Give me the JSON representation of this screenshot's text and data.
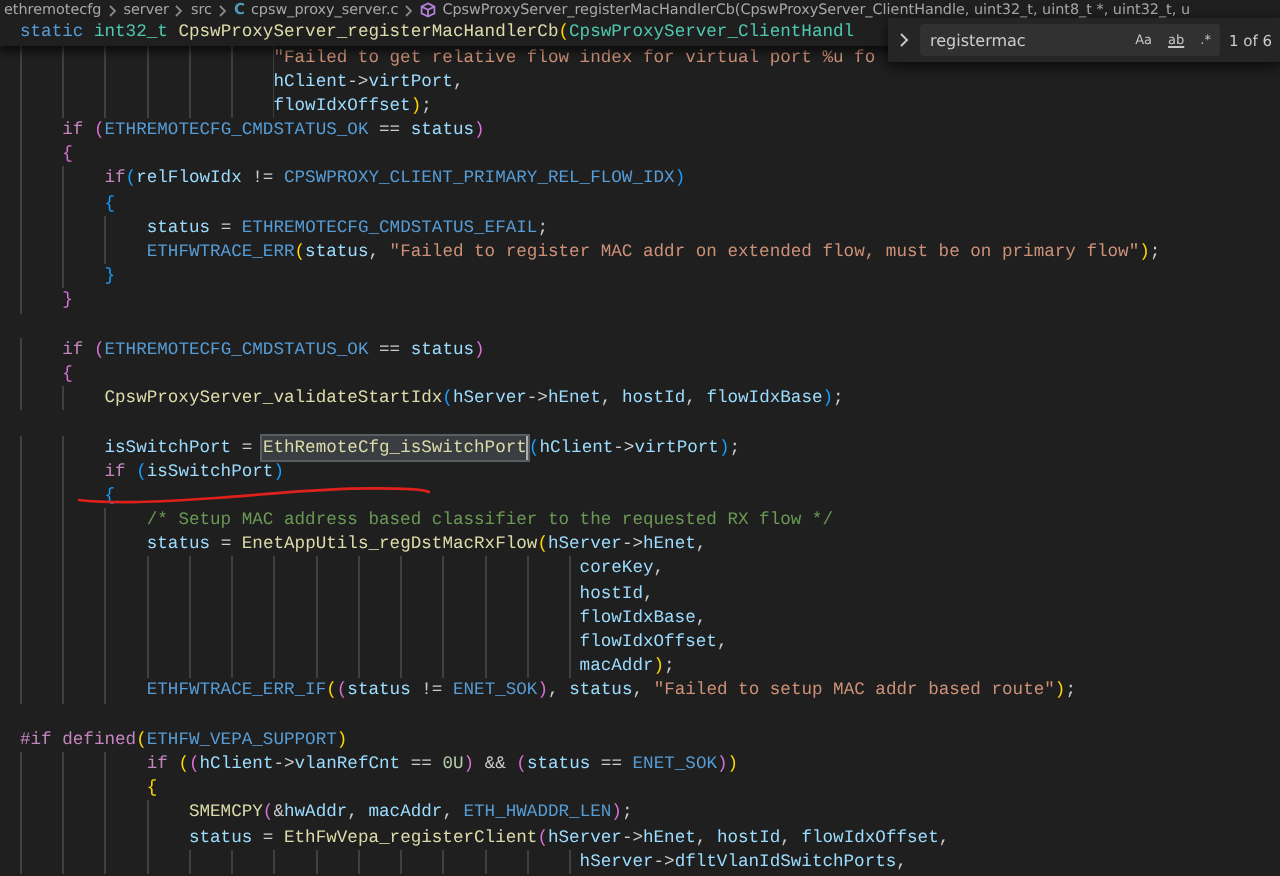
{
  "breadcrumb": {
    "items": [
      {
        "kind": "folder",
        "text": "ethremotecfg"
      },
      {
        "kind": "folder",
        "text": "server"
      },
      {
        "kind": "folder",
        "text": "src"
      },
      {
        "kind": "file",
        "glyph": "C",
        "text": "cpsw_proxy_server.c"
      },
      {
        "kind": "method",
        "text": "CpswProxyServer_registerMacHandlerCb(CpswProxyServer_ClientHandle, uint32_t, uint8_t *, uint32_t, u"
      }
    ]
  },
  "sticky_line": {
    "tokens": [
      {
        "kind": "st",
        "text": "static"
      },
      {
        "kind": "ty",
        "text": " int32_t"
      },
      {
        "kind": "fn",
        "text": " CpswProxyServer_registerMacHandlerCb"
      },
      {
        "kind": "b1",
        "text": "("
      },
      {
        "kind": "ty",
        "text": "CpswProxyServer_ClientHandl"
      }
    ]
  },
  "find_widget": {
    "query": "registermac",
    "options": [
      {
        "label": "Aa",
        "selected": false
      },
      {
        "label": "ab",
        "selected": false
      },
      {
        "label": ".*",
        "selected": false
      }
    ],
    "result": "1 of 6"
  },
  "lines": [
    {
      "kind": "code",
      "tokens": [
        {
          "kind": "str",
          "text": "                        \"Failed to get relative flow index for virtual port %u fo"
        }
      ]
    },
    {
      "kind": "code",
      "tokens": [
        {
          "kind": "var",
          "text": "                        hClient"
        },
        {
          "kind": "pl",
          "text": "->"
        },
        {
          "kind": "var",
          "text": "virtPort"
        },
        {
          "kind": "pl",
          "text": ","
        }
      ]
    },
    {
      "kind": "code",
      "tokens": [
        {
          "kind": "var",
          "text": "                        flowIdxOffset"
        },
        {
          "kind": "b1",
          "text": ")"
        },
        {
          "kind": "pl",
          "text": ";"
        }
      ]
    },
    {
      "kind": "code",
      "tokens": [
        {
          "kind": "kw",
          "text": "    if"
        },
        {
          "kind": "b2",
          "text": " ("
        },
        {
          "kind": "st",
          "text": "ETHREMOTECFG_CMDSTATUS_OK"
        },
        {
          "kind": "pl",
          "text": " == "
        },
        {
          "kind": "var",
          "text": "status"
        },
        {
          "kind": "b2",
          "text": ")"
        }
      ]
    },
    {
      "kind": "code",
      "tokens": [
        {
          "kind": "b2",
          "text": "    {"
        }
      ]
    },
    {
      "kind": "code",
      "tokens": [
        {
          "kind": "kw",
          "text": "        if"
        },
        {
          "kind": "b3",
          "text": "("
        },
        {
          "kind": "var",
          "text": "relFlowIdx"
        },
        {
          "kind": "pl",
          "text": " != "
        },
        {
          "kind": "st",
          "text": "CPSWPROXY_CLIENT_PRIMARY_REL_FLOW_IDX"
        },
        {
          "kind": "b3",
          "text": ")"
        }
      ]
    },
    {
      "kind": "code",
      "tokens": [
        {
          "kind": "b3",
          "text": "        {"
        }
      ]
    },
    {
      "kind": "code",
      "tokens": [
        {
          "kind": "var",
          "text": "            status"
        },
        {
          "kind": "pl",
          "text": " = "
        },
        {
          "kind": "st",
          "text": "ETHREMOTECFG_CMDSTATUS_EFAIL"
        },
        {
          "kind": "pl",
          "text": ";"
        }
      ]
    },
    {
      "kind": "code",
      "tokens": [
        {
          "kind": "st",
          "text": "            ETHFWTRACE_ERR"
        },
        {
          "kind": "b1",
          "text": "("
        },
        {
          "kind": "var",
          "text": "status"
        },
        {
          "kind": "pl",
          "text": ", "
        },
        {
          "kind": "str",
          "text": "\"Failed to register MAC addr on extended flow, must be on primary flow\""
        },
        {
          "kind": "b1",
          "text": ")"
        },
        {
          "kind": "pl",
          "text": ";"
        }
      ]
    },
    {
      "kind": "code",
      "tokens": [
        {
          "kind": "b3",
          "text": "        }"
        }
      ]
    },
    {
      "kind": "code",
      "tokens": [
        {
          "kind": "b2",
          "text": "    }"
        }
      ]
    },
    {
      "kind": "blank"
    },
    {
      "kind": "code",
      "tokens": [
        {
          "kind": "kw",
          "text": "    if"
        },
        {
          "kind": "b2",
          "text": " ("
        },
        {
          "kind": "st",
          "text": "ETHREMOTECFG_CMDSTATUS_OK"
        },
        {
          "kind": "pl",
          "text": " == "
        },
        {
          "kind": "var",
          "text": "status"
        },
        {
          "kind": "b2",
          "text": ")"
        }
      ]
    },
    {
      "kind": "code",
      "tokens": [
        {
          "kind": "b2",
          "text": "    {"
        }
      ]
    },
    {
      "kind": "code",
      "tokens": [
        {
          "kind": "fn",
          "text": "        CpswProxyServer_validateStartIdx"
        },
        {
          "kind": "b3",
          "text": "("
        },
        {
          "kind": "var",
          "text": "hServer"
        },
        {
          "kind": "pl",
          "text": "->"
        },
        {
          "kind": "var",
          "text": "hEnet"
        },
        {
          "kind": "pl",
          "text": ", "
        },
        {
          "kind": "var",
          "text": "hostId"
        },
        {
          "kind": "pl",
          "text": ", "
        },
        {
          "kind": "var",
          "text": "flowIdxBase"
        },
        {
          "kind": "b3",
          "text": ")"
        },
        {
          "kind": "pl",
          "text": ";"
        }
      ]
    },
    {
      "kind": "blank"
    },
    {
      "kind": "code",
      "tokens": [
        {
          "kind": "var",
          "text": "        isSwitchPort"
        },
        {
          "kind": "pl",
          "text": " = "
        },
        {
          "kind": "hl",
          "text": "EthRemoteCfg_isSwitchPort"
        },
        {
          "kind": "b3",
          "text": "("
        },
        {
          "kind": "var",
          "text": "hClient"
        },
        {
          "kind": "pl",
          "text": "->"
        },
        {
          "kind": "var",
          "text": "virtPort"
        },
        {
          "kind": "b3",
          "text": ")"
        },
        {
          "kind": "pl",
          "text": ";"
        }
      ]
    },
    {
      "kind": "code",
      "tokens": [
        {
          "kind": "kw",
          "text": "        if"
        },
        {
          "kind": "b3",
          "text": " ("
        },
        {
          "kind": "var",
          "text": "isSwitchPort"
        },
        {
          "kind": "b3",
          "text": ")"
        }
      ]
    },
    {
      "kind": "code",
      "tokens": [
        {
          "kind": "b3",
          "text": "        {"
        }
      ]
    },
    {
      "kind": "code",
      "tokens": [
        {
          "kind": "cmt",
          "text": "            /* Setup MAC address based classifier to the requested RX flow */"
        }
      ]
    },
    {
      "kind": "code",
      "tokens": [
        {
          "kind": "var",
          "text": "            status"
        },
        {
          "kind": "pl",
          "text": " = "
        },
        {
          "kind": "fn",
          "text": "EnetAppUtils_regDstMacRxFlow"
        },
        {
          "kind": "b1",
          "text": "("
        },
        {
          "kind": "var",
          "text": "hServer"
        },
        {
          "kind": "pl",
          "text": "->"
        },
        {
          "kind": "var",
          "text": "hEnet"
        },
        {
          "kind": "pl",
          "text": ","
        }
      ]
    },
    {
      "kind": "code",
      "tokens": [
        {
          "kind": "var",
          "text": "                                                     coreKey"
        },
        {
          "kind": "pl",
          "text": ","
        }
      ]
    },
    {
      "kind": "code",
      "tokens": [
        {
          "kind": "var",
          "text": "                                                     hostId"
        },
        {
          "kind": "pl",
          "text": ","
        }
      ]
    },
    {
      "kind": "code",
      "tokens": [
        {
          "kind": "var",
          "text": "                                                     flowIdxBase"
        },
        {
          "kind": "pl",
          "text": ","
        }
      ]
    },
    {
      "kind": "code",
      "tokens": [
        {
          "kind": "var",
          "text": "                                                     flowIdxOffset"
        },
        {
          "kind": "pl",
          "text": ","
        }
      ]
    },
    {
      "kind": "code",
      "tokens": [
        {
          "kind": "var",
          "text": "                                                     macAddr"
        },
        {
          "kind": "b1",
          "text": ")"
        },
        {
          "kind": "pl",
          "text": ";"
        }
      ]
    },
    {
      "kind": "code",
      "tokens": [
        {
          "kind": "st",
          "text": "            ETHFWTRACE_ERR_IF"
        },
        {
          "kind": "b1",
          "text": "("
        },
        {
          "kind": "b2",
          "text": "("
        },
        {
          "kind": "var",
          "text": "status"
        },
        {
          "kind": "pl",
          "text": " != "
        },
        {
          "kind": "st",
          "text": "ENET_SOK"
        },
        {
          "kind": "b2",
          "text": ")"
        },
        {
          "kind": "pl",
          "text": ", "
        },
        {
          "kind": "var",
          "text": "status"
        },
        {
          "kind": "pl",
          "text": ", "
        },
        {
          "kind": "str",
          "text": "\"Failed to setup MAC addr based route\""
        },
        {
          "kind": "b1",
          "text": ")"
        },
        {
          "kind": "pl",
          "text": ";"
        }
      ]
    },
    {
      "kind": "blank"
    },
    {
      "kind": "code",
      "tokens": [
        {
          "kind": "kw",
          "text": "#if"
        },
        {
          "kind": "kw",
          "text": " defined"
        },
        {
          "kind": "b1",
          "text": "("
        },
        {
          "kind": "st",
          "text": "ETHFW_VEPA_SUPPORT"
        },
        {
          "kind": "b1",
          "text": ")"
        }
      ]
    },
    {
      "kind": "code",
      "tokens": [
        {
          "kind": "kw",
          "text": "            if"
        },
        {
          "kind": "b1",
          "text": " ("
        },
        {
          "kind": "b2",
          "text": "("
        },
        {
          "kind": "var",
          "text": "hClient"
        },
        {
          "kind": "pl",
          "text": "->"
        },
        {
          "kind": "var",
          "text": "vlanRefCnt"
        },
        {
          "kind": "pl",
          "text": " == "
        },
        {
          "kind": "num",
          "text": "0U"
        },
        {
          "kind": "b2",
          "text": ")"
        },
        {
          "kind": "pl",
          "text": " && "
        },
        {
          "kind": "b2",
          "text": "("
        },
        {
          "kind": "var",
          "text": "status"
        },
        {
          "kind": "pl",
          "text": " == "
        },
        {
          "kind": "st",
          "text": "ENET_SOK"
        },
        {
          "kind": "b2",
          "text": ")"
        },
        {
          "kind": "b1",
          "text": ")"
        }
      ]
    },
    {
      "kind": "code",
      "tokens": [
        {
          "kind": "b1",
          "text": "            {"
        }
      ]
    },
    {
      "kind": "code",
      "tokens": [
        {
          "kind": "fn",
          "text": "                SMEMCPY"
        },
        {
          "kind": "b2",
          "text": "("
        },
        {
          "kind": "pl",
          "text": "&"
        },
        {
          "kind": "var",
          "text": "hwAddr"
        },
        {
          "kind": "pl",
          "text": ", "
        },
        {
          "kind": "var",
          "text": "macAddr"
        },
        {
          "kind": "pl",
          "text": ", "
        },
        {
          "kind": "st",
          "text": "ETH_HWADDR_LEN"
        },
        {
          "kind": "b2",
          "text": ")"
        },
        {
          "kind": "pl",
          "text": ";"
        }
      ]
    },
    {
      "kind": "code",
      "tokens": [
        {
          "kind": "var",
          "text": "                status"
        },
        {
          "kind": "pl",
          "text": " = "
        },
        {
          "kind": "fn",
          "text": "EthFwVepa_registerClient"
        },
        {
          "kind": "b2",
          "text": "("
        },
        {
          "kind": "var",
          "text": "hServer"
        },
        {
          "kind": "pl",
          "text": "->"
        },
        {
          "kind": "var",
          "text": "hEnet"
        },
        {
          "kind": "pl",
          "text": ", "
        },
        {
          "kind": "var",
          "text": "hostId"
        },
        {
          "kind": "pl",
          "text": ", "
        },
        {
          "kind": "var",
          "text": "flowIdxOffset"
        },
        {
          "kind": "pl",
          "text": ","
        }
      ]
    },
    {
      "kind": "code",
      "tokens": [
        {
          "kind": "var",
          "text": "                                                     hServer"
        },
        {
          "kind": "pl",
          "text": "->"
        },
        {
          "kind": "var",
          "text": "dfltVlanIdSwitchPorts"
        },
        {
          "kind": "pl",
          "text": ","
        }
      ]
    }
  ]
}
